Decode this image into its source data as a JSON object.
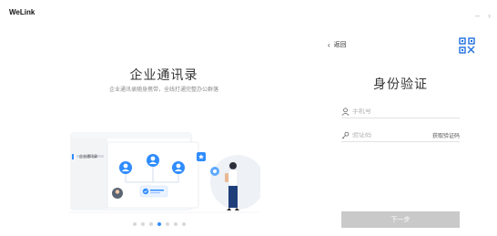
{
  "app": {
    "title": "WeLink",
    "minimize_glyph": "–",
    "close_glyph": "›"
  },
  "promo": {
    "title": "企业通讯录",
    "subtitle": "企业通讯录随身携带，全线打通完整办公群落",
    "illustration": {
      "sidebar_item_label": "企业通讯录",
      "icons": [
        "avatar-icon",
        "star-icon",
        "gear-icon",
        "check-icon"
      ]
    },
    "pagination": {
      "count": 7,
      "active_index": 3
    }
  },
  "login": {
    "back_label": "返回",
    "back_glyph": "‹",
    "qr_icon": "qrcode-icon",
    "title": "身份验证",
    "phone": {
      "placeholder": "手机号",
      "icon": "user-icon"
    },
    "code": {
      "placeholder": "验证码",
      "icon": "key-icon",
      "get_code_label": "获取验证码"
    },
    "next_label": "下一步",
    "next_enabled": false
  },
  "colors": {
    "accent": "#2f8cff",
    "button_disabled": "#c9c9c9",
    "qr": "#1f6fe0"
  }
}
